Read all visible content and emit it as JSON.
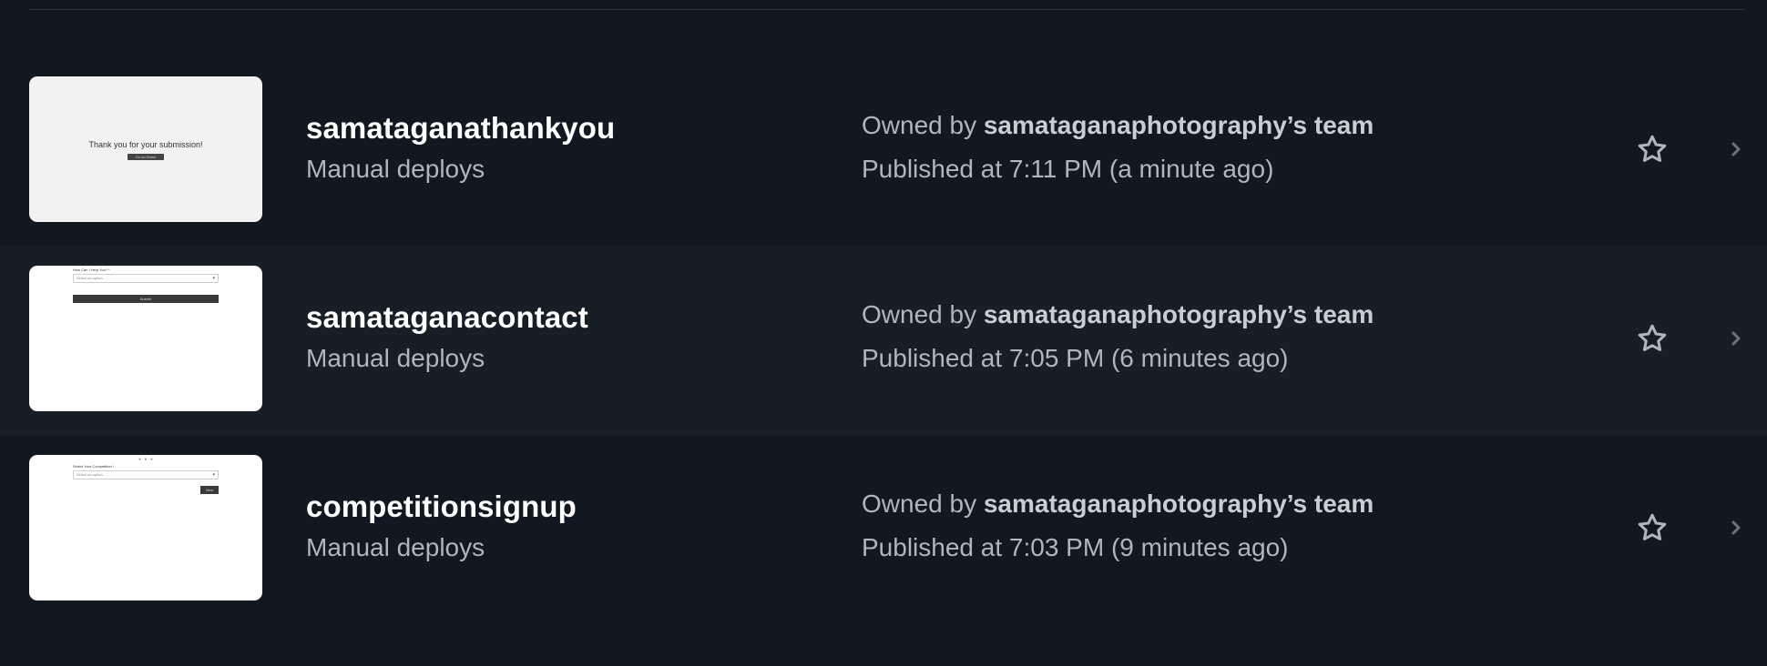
{
  "sites": [
    {
      "name": "samataganathankyou",
      "deploy_type": "Manual deploys",
      "owner_prefix": "Owned by",
      "owner_team": "samataganaphotography’s team",
      "published": "Published at 7:11 PM (a minute ago)",
      "preview": {
        "heading": "Thank you for your submission!",
        "button": "Go on Home"
      }
    },
    {
      "name": "samataganacontact",
      "deploy_type": "Manual deploys",
      "owner_prefix": "Owned by",
      "owner_team": "samataganaphotography’s team",
      "published": "Published at 7:05 PM (6 minutes ago)",
      "preview": {
        "label": "How Can I Help You? *",
        "select_placeholder": "Select an option",
        "button": "Submit"
      }
    },
    {
      "name": "competitionsignup",
      "deploy_type": "Manual deploys",
      "owner_prefix": "Owned by",
      "owner_team": "samataganaphotography’s team",
      "published": "Published at 7:03 PM (9 minutes ago)",
      "preview": {
        "steps": "● ● ●",
        "label": "Select Your Competition *",
        "select_placeholder": "Select an option",
        "button": "Next"
      }
    }
  ],
  "icons": {
    "favorite": "star-outline-icon",
    "open": "chevron-right-icon"
  },
  "colors": {
    "background": "#111821",
    "row_alt": "#161e27",
    "muted_text": "#aeb6c2",
    "icon": "#aeb6c2"
  }
}
